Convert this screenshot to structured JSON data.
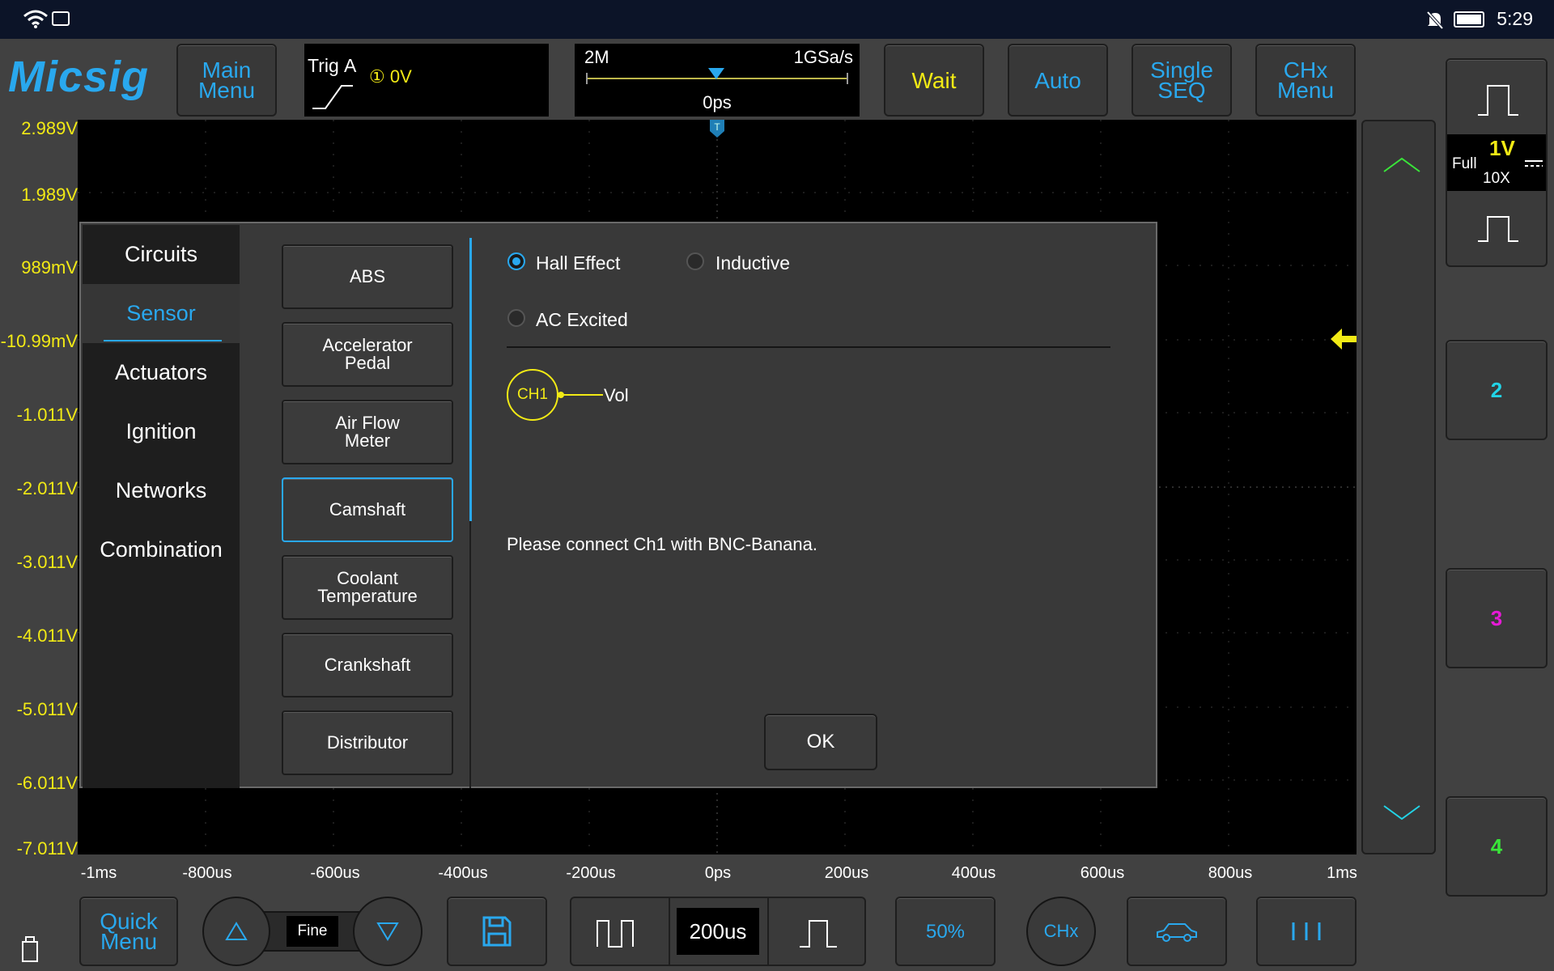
{
  "statusbar": {
    "time": "5:29"
  },
  "brand": {
    "logo": "Micsig"
  },
  "toolbar": {
    "main_menu": "Main Menu",
    "trig_title": "Trig",
    "trig_source": "A",
    "trig_channel_level": "① 0V",
    "memory_depth": "2M",
    "sample_rate": "1GSa/s",
    "time_offset": "0ps",
    "wait": "Wait",
    "auto": "Auto",
    "single_seq": "Single SEQ",
    "chx_menu": "CHx Menu"
  },
  "vertical_labels": [
    "2.989V",
    "1.989V",
    "989mV",
    "-10.99mV",
    "-1.011V",
    "-2.011V",
    "-3.011V",
    "-4.011V",
    "-5.011V",
    "-6.011V",
    "-7.011V"
  ],
  "time_labels": [
    "-1ms",
    "-800us",
    "-600us",
    "-400us",
    "-200us",
    "0ps",
    "200us",
    "400us",
    "600us",
    "800us",
    "1ms"
  ],
  "right_panel": {
    "ch1_volts": "1V",
    "ch1_bandwidth": "Full",
    "ch1_probe": "10X",
    "ch2": "2",
    "ch3": "3",
    "ch4": "4"
  },
  "dialog": {
    "categories": [
      "Circuits",
      "Sensor",
      "Actuators",
      "Ignition",
      "Networks",
      "Combination"
    ],
    "selected_category": "Sensor",
    "sensors": [
      "ABS",
      "Accelerator Pedal",
      "Air Flow Meter",
      "Camshaft",
      "Coolant Temperature",
      "Crankshaft",
      "Distributor"
    ],
    "selected_sensor": "Camshaft",
    "options": {
      "hall_effect": "Hall Effect",
      "inductive": "Inductive",
      "ac_excited": "AC Excited"
    },
    "selected_option": "Hall Effect",
    "channel_badge": "CH1",
    "channel_measure": "Vol",
    "instruction": "Please connect Ch1 with BNC-Banana.",
    "ok": "OK"
  },
  "bottombar": {
    "quick_menu": "Quick Menu",
    "fine": "Fine",
    "timebase": "200us",
    "trigger_50": "50%",
    "chx": "CHx"
  },
  "colors": {
    "accent": "#29a8ee",
    "ch1": "#f2ea15",
    "ch2": "#22d3e6",
    "ch3": "#e61ad6",
    "ch4": "#39e639"
  },
  "icons": [
    "wifi-icon",
    "bell-off-icon",
    "battery-icon",
    "rising-edge-icon",
    "trigger-marker-icon",
    "pulse-icon",
    "chevron-up-icon",
    "chevron-down-icon",
    "ch1-level-arrow-icon",
    "arrow-up-icon",
    "arrow-down-icon",
    "save-icon",
    "square-wave-icon",
    "single-pulse-icon",
    "car-icon",
    "cursor-bars-icon",
    "usb-stick-icon"
  ]
}
